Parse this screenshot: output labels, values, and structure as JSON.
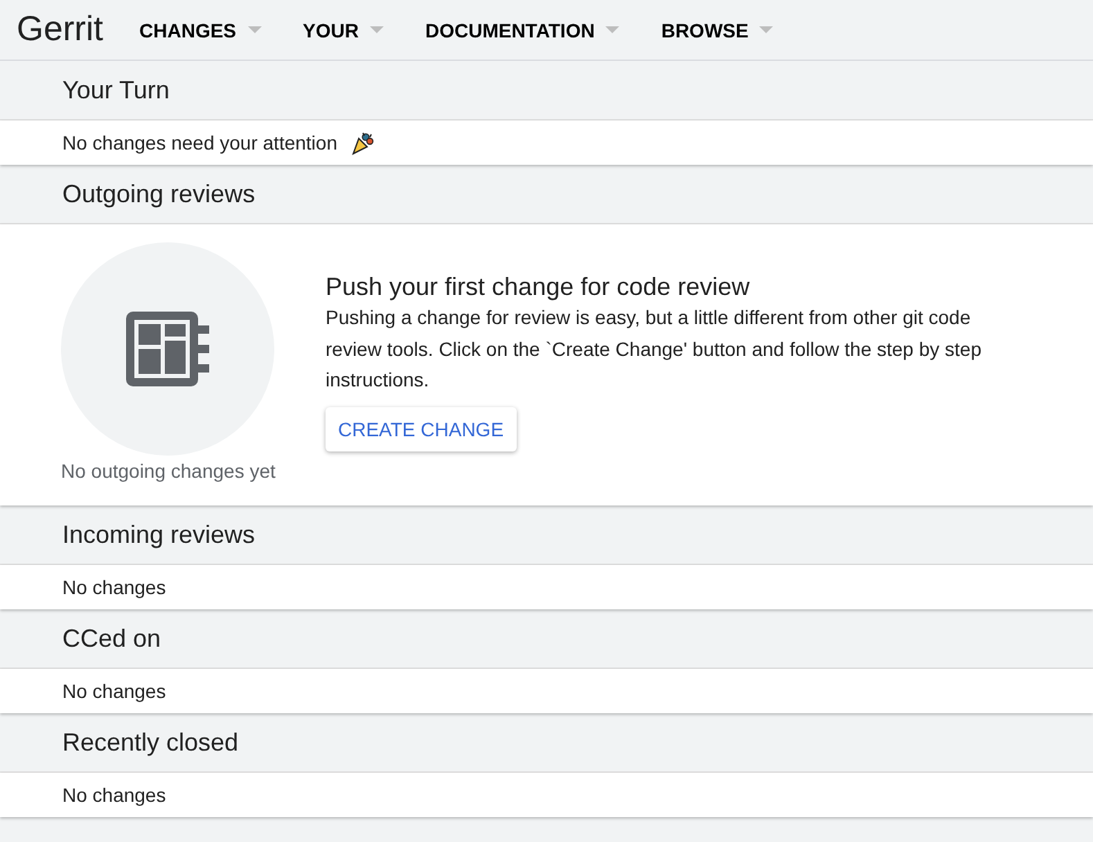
{
  "header": {
    "logo": "Gerrit",
    "menus": [
      {
        "label": "CHANGES"
      },
      {
        "label": "YOUR"
      },
      {
        "label": "DOCUMENTATION"
      },
      {
        "label": "BROWSE"
      }
    ]
  },
  "sections": [
    {
      "kind": "simple",
      "title": "Your Turn",
      "message": "No changes need your attention",
      "celebrate": true
    },
    {
      "kind": "empty_state",
      "title": "Outgoing reviews",
      "caption": "No outgoing changes yet",
      "heading": "Push your first change for code review",
      "text": "Pushing a change for review is easy, but a little different from other git code review tools. Click on the `Create Change' button and follow the step by step instructions.",
      "button": "CREATE CHANGE"
    },
    {
      "kind": "simple",
      "title": "Incoming reviews",
      "message": "No changes",
      "celebrate": false
    },
    {
      "kind": "simple",
      "title": "CCed on",
      "message": "No changes",
      "celebrate": false
    },
    {
      "kind": "simple",
      "title": "Recently closed",
      "message": "No changes",
      "celebrate": false
    }
  ]
}
